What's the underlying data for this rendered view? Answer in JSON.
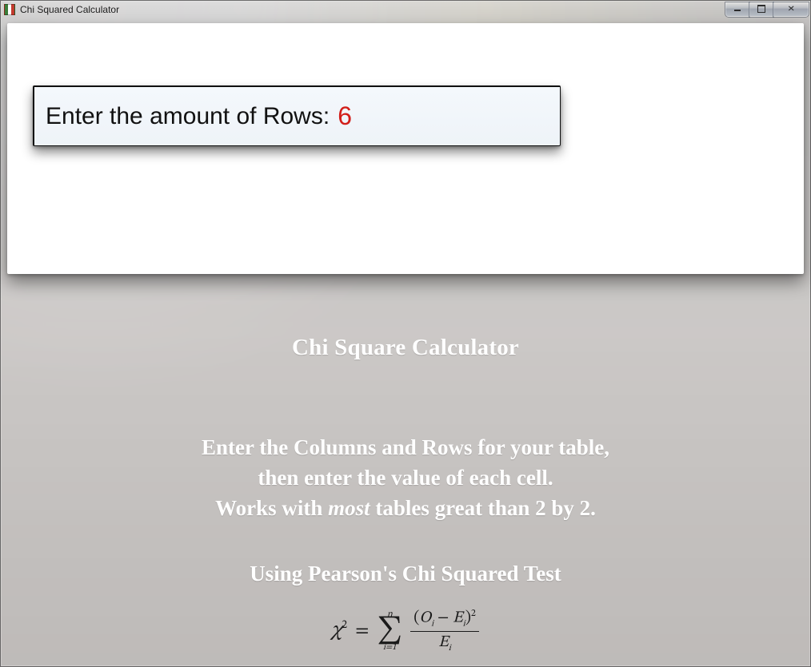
{
  "window": {
    "title": "Chi Squared Calculator"
  },
  "input": {
    "label": "Enter the amount of Rows:",
    "value": "6"
  },
  "info": {
    "heading": "Chi Square Calculator",
    "line1": "Enter the Columns and Rows for your table,",
    "line2": "then enter the value of each cell.",
    "line3_pre": "Works with ",
    "line3_em": "most",
    "line3_post": " tables great than 2 by 2.",
    "subhead": "Using Pearson's Chi Squared Test"
  },
  "formula": {
    "lhs_var": "χ",
    "lhs_exp": "2",
    "equals": "=",
    "sum_upper": "n",
    "sum_symbol": "∑",
    "sum_lower": "i=1",
    "num_open": "(",
    "num_O": "O",
    "num_sub": "i",
    "num_minus": " − ",
    "num_E": "E",
    "num_sub2": "i",
    "num_close": ")",
    "num_exp": "2",
    "den_E": "E",
    "den_sub": "i"
  }
}
